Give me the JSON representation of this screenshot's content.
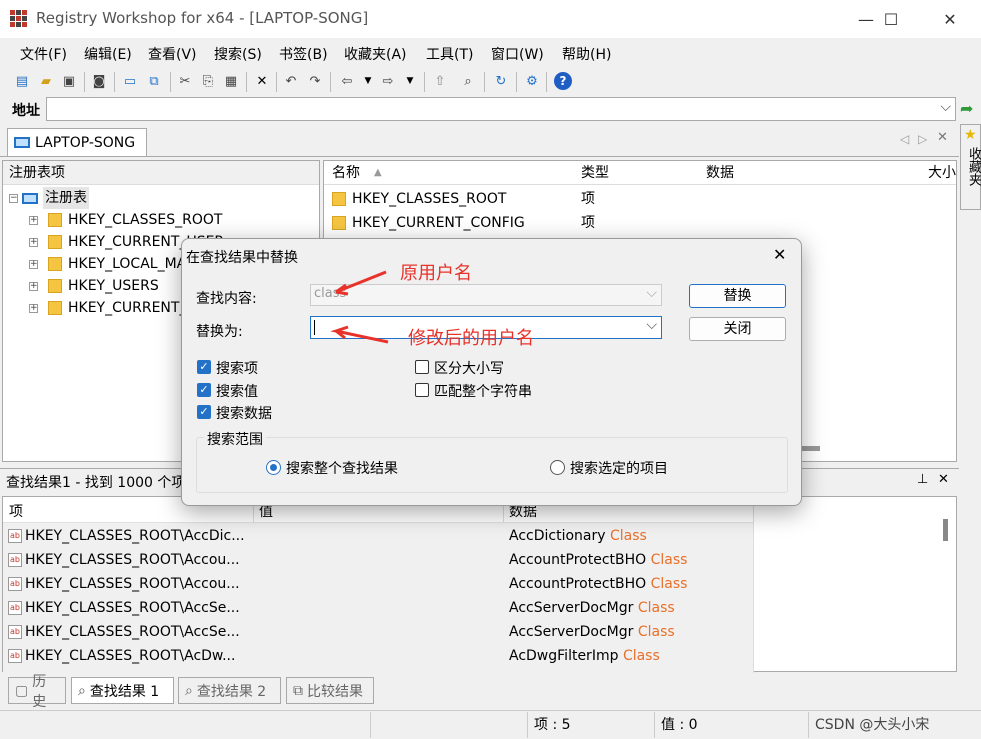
{
  "window": {
    "title": "Registry Workshop for x64 - [LAPTOP-SONG]",
    "controls": {
      "minimize": "—",
      "maximize": "☐",
      "close": "✕"
    }
  },
  "menu": [
    "文件(F)",
    "编辑(E)",
    "查看(V)",
    "搜索(S)",
    "书签(B)",
    "收藏夹(A)",
    "工具(T)",
    "窗口(W)",
    "帮助(H)"
  ],
  "address": {
    "label": "地址",
    "value": ""
  },
  "tab": {
    "label": "LAPTOP-SONG"
  },
  "favorites": {
    "label": "收藏夹"
  },
  "tree": {
    "header": "注册表项",
    "root": "注册表",
    "items": [
      "HKEY_CLASSES_ROOT",
      "HKEY_CURRENT_USER",
      "HKEY_LOCAL_MACHINE",
      "HKEY_USERS",
      "HKEY_CURRENT_CONFIG"
    ]
  },
  "values_list": {
    "columns": [
      "名称",
      "类型",
      "数据",
      "大小"
    ],
    "rows": [
      {
        "name": "HKEY_CLASSES_ROOT",
        "type": "项"
      },
      {
        "name": "HKEY_CURRENT_CONFIG",
        "type": "项"
      }
    ]
  },
  "dialog": {
    "title": "在查找结果中替换",
    "find_label": "查找内容:",
    "find_value": "class",
    "replace_label": "替换为:",
    "replace_value": "",
    "replace_button": "替换",
    "close_button": "关闭",
    "checkboxes": [
      {
        "label": "搜索项",
        "checked": true
      },
      {
        "label": "搜索值",
        "checked": true
      },
      {
        "label": "搜索数据",
        "checked": true
      },
      {
        "label": "区分大小写",
        "checked": false
      },
      {
        "label": "匹配整个字符串",
        "checked": false
      }
    ],
    "scope_group": "搜索范围",
    "scope_options": [
      {
        "label": "搜索整个查找结果",
        "selected": true
      },
      {
        "label": "搜索选定的项目",
        "selected": false
      }
    ]
  },
  "annotations": {
    "original": "原用户名",
    "modified": "修改后的用户名",
    "color": "#e8322a"
  },
  "results": {
    "header": "查找结果1 - 找到 1000 个项",
    "columns": [
      "项",
      "值",
      "数据"
    ],
    "rows": [
      {
        "key": "HKEY_CLASSES_ROOT\\AccDic...",
        "data": "AccDictionary",
        "suffix": "Class"
      },
      {
        "key": "HKEY_CLASSES_ROOT\\Accou...",
        "data": "AccountProtectBHO",
        "suffix": "Class"
      },
      {
        "key": "HKEY_CLASSES_ROOT\\Accou...",
        "data": "AccountProtectBHO",
        "suffix": "Class"
      },
      {
        "key": "HKEY_CLASSES_ROOT\\AccSe...",
        "data": "AccServerDocMgr",
        "suffix": "Class"
      },
      {
        "key": "HKEY_CLASSES_ROOT\\AccSe...",
        "data": "AccServerDocMgr",
        "suffix": "Class"
      },
      {
        "key": "HKEY_CLASSES_ROOT\\AcDw...",
        "data": "AcDwgFilterImp",
        "suffix": "Class"
      }
    ]
  },
  "bottom_tabs": [
    "历史",
    "查找结果 1",
    "查找结果 2",
    "比较结果"
  ],
  "status": {
    "items": "项 : 5",
    "values": "值 : 0",
    "watermark": "CSDN @大头小宋"
  }
}
